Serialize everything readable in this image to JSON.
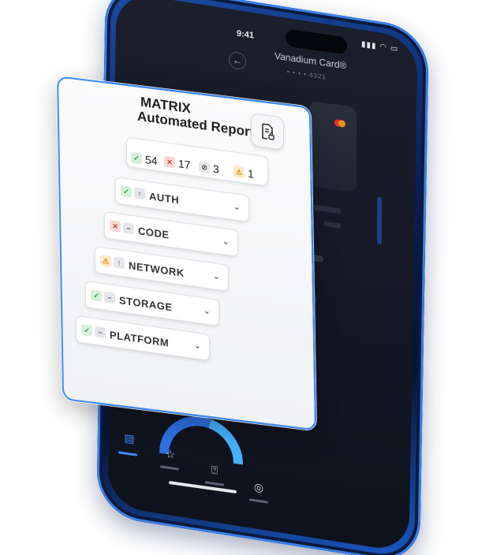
{
  "phone": {
    "status_time": "9:41",
    "card_title": "Vanadium Card®",
    "card_number_masked": "• • • •  4321",
    "back_icon": "arrow-left-icon",
    "nav_items": [
      {
        "icon": "layout-icon",
        "glyph": "▤",
        "active": true
      },
      {
        "icon": "star-icon",
        "glyph": "☆",
        "active": false
      },
      {
        "icon": "question-box-icon",
        "glyph": "⍰",
        "active": false
      },
      {
        "icon": "profile-icon",
        "glyph": "◎",
        "active": false
      }
    ],
    "accent_color": "#3f8cff"
  },
  "report": {
    "title_line1": "MATRIX",
    "title_line2": "Automated Report",
    "doc_icon": "document-lock-icon",
    "summary": {
      "passed": "54",
      "failed": "17",
      "skipped": "3",
      "warnings": "1"
    },
    "rows": [
      {
        "label": "AUTH",
        "badges": [
          "check",
          "up"
        ]
      },
      {
        "label": "CODE",
        "badges": [
          "cross",
          "dash"
        ]
      },
      {
        "label": "NETWORK",
        "badges": [
          "warn",
          "up"
        ]
      },
      {
        "label": "STORAGE",
        "badges": [
          "check",
          "dash"
        ]
      },
      {
        "label": "PLATFORM",
        "badges": [
          "check",
          "dash"
        ]
      }
    ],
    "colors": {
      "border": "#3b8bff",
      "pass": "#2a9a47",
      "fail": "#d23c3c",
      "warn": "#d08b10"
    }
  }
}
